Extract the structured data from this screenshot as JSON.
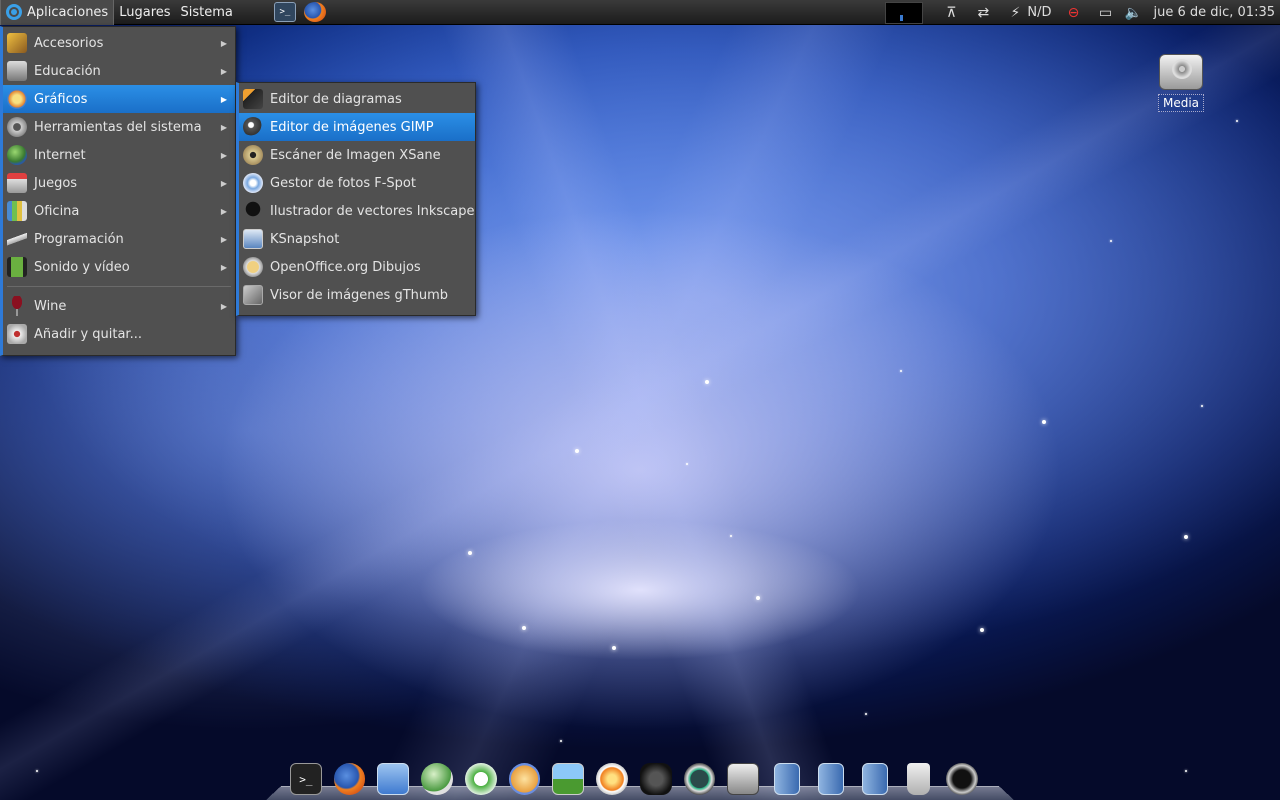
{
  "top_panel": {
    "menus": [
      "Aplicaciones",
      "Lugares",
      "Sistema"
    ],
    "launchers": [
      "terminal-icon",
      "firefox-icon"
    ],
    "tray": {
      "network_status": "N/D",
      "clock": "jue  6 de dic, 01:35"
    }
  },
  "apps_menu": {
    "items": [
      {
        "label": "Accesorios",
        "icon": "accessories-icon",
        "submenu": true
      },
      {
        "label": "Educación",
        "icon": "education-icon",
        "submenu": true
      },
      {
        "label": "Gráficos",
        "icon": "graphics-icon",
        "submenu": true,
        "highlighted": true
      },
      {
        "label": "Herramientas del sistema",
        "icon": "system-tools-icon",
        "submenu": true
      },
      {
        "label": "Internet",
        "icon": "internet-icon",
        "submenu": true
      },
      {
        "label": "Juegos",
        "icon": "games-icon",
        "submenu": true
      },
      {
        "label": "Oficina",
        "icon": "office-icon",
        "submenu": true
      },
      {
        "label": "Programación",
        "icon": "programming-icon",
        "submenu": true
      },
      {
        "label": "Sonido y vídeo",
        "icon": "sound-video-icon",
        "submenu": true
      }
    ],
    "extra_items": [
      {
        "label": "Wine",
        "icon": "wine-icon",
        "submenu": true
      },
      {
        "label": "Añadir y quitar...",
        "icon": "add-remove-icon",
        "submenu": false
      }
    ]
  },
  "graphics_submenu": {
    "items": [
      {
        "label": "Editor de diagramas",
        "icon": "dia-icon"
      },
      {
        "label": "Editor de imágenes GIMP",
        "icon": "gimp-icon",
        "highlighted": true
      },
      {
        "label": "Escáner de Imagen XSane",
        "icon": "xsane-icon"
      },
      {
        "label": "Gestor de fotos F-Spot",
        "icon": "fspot-icon"
      },
      {
        "label": "Ilustrador de vectores Inkscape",
        "icon": "inkscape-icon"
      },
      {
        "label": "KSnapshot",
        "icon": "ksnapshot-icon"
      },
      {
        "label": "OpenOffice.org Dibujos",
        "icon": "oo-draw-icon"
      },
      {
        "label": "Visor de imágenes gThumb",
        "icon": "gthumb-icon"
      }
    ]
  },
  "desktop": {
    "icons": [
      {
        "label": "Media",
        "icon": "drive-icon"
      }
    ]
  },
  "dock": {
    "items": [
      "terminal-icon",
      "firefox-icon",
      "text-editor-icon",
      "browser-icon",
      "music-player-icon",
      "paint-icon",
      "image-viewer-icon",
      "burner-icon",
      "binoculars-icon",
      "time-machine-icon",
      "hard-drive-icon",
      "folder-icon",
      "folder-icon",
      "folder-icon",
      "trash-icon",
      "power-icon"
    ]
  },
  "colors": {
    "highlight": "#1f7fd8",
    "menu_bg": "#505050",
    "panel_bg": "#2a2a2a"
  }
}
